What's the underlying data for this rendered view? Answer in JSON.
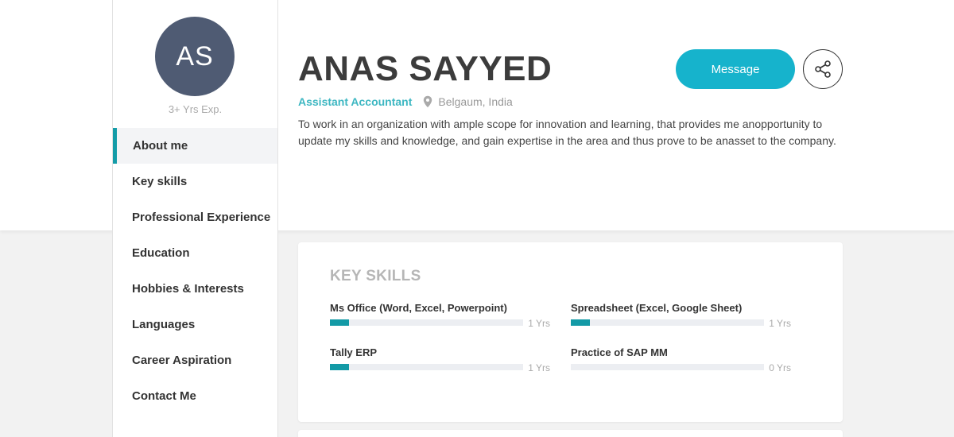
{
  "profile": {
    "initials": "AS",
    "experience": "3+ Yrs Exp.",
    "name": "ANAS SAYYED",
    "job_title": "Assistant Accountant",
    "location": "Belgaum, India",
    "bio": "To work in an organization with ample scope for innovation and learning, that provides me anopportunity to update my skills and knowledge, and gain expertise in the area and thus prove to be anasset to the company."
  },
  "actions": {
    "message_label": "Message",
    "share_icon": "share-icon"
  },
  "icons": {
    "location": "map-pin-icon",
    "share": "share-icon"
  },
  "nav": {
    "items": [
      {
        "label": "About me",
        "active": true
      },
      {
        "label": "Key skills",
        "active": false
      },
      {
        "label": "Professional Experience",
        "active": false
      },
      {
        "label": "Education",
        "active": false
      },
      {
        "label": "Hobbies & Interests",
        "active": false
      },
      {
        "label": "Languages",
        "active": false
      },
      {
        "label": "Career Aspiration",
        "active": false
      },
      {
        "label": "Contact Me",
        "active": false
      }
    ]
  },
  "key_skills": {
    "title": "KEY SKILLS",
    "skills": [
      {
        "name": "Ms Office (Word, Excel, Powerpoint)",
        "years": "1 Yrs",
        "level": 0.1
      },
      {
        "name": "Spreadsheet (Excel, Google Sheet)",
        "years": "1 Yrs",
        "level": 0.1
      },
      {
        "name": "Tally ERP",
        "years": "1 Yrs",
        "level": 0.1
      },
      {
        "name": "Practice of SAP MM",
        "years": "0 Yrs",
        "level": 0
      }
    ]
  },
  "colors": {
    "accent": "#16b3cc",
    "nav_active_bar": "#149ca8",
    "skill_fill": "#139aa6",
    "avatar_bg": "#4f5b73",
    "job_title": "#3db7c2"
  }
}
